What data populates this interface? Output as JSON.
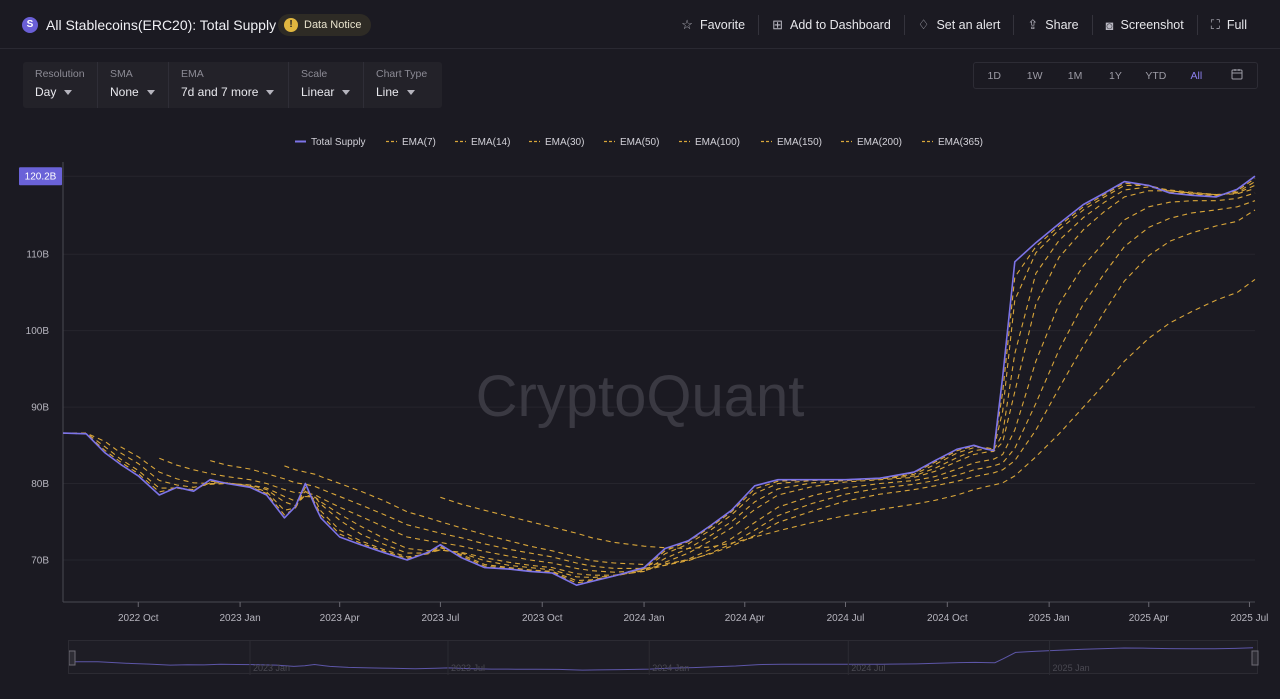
{
  "header": {
    "logo_letter": "S",
    "title": "All Stablecoins(ERC20): Total Supply",
    "notice": "Data Notice",
    "actions": [
      {
        "label": "Favorite",
        "icon": "star-icon"
      },
      {
        "label": "Add to Dashboard",
        "icon": "dashboard-add-icon"
      },
      {
        "label": "Set an alert",
        "icon": "bell-icon"
      },
      {
        "label": "Share",
        "icon": "share-icon"
      },
      {
        "label": "Screenshot",
        "icon": "camera-icon"
      },
      {
        "label": "Full",
        "icon": "fullscreen-icon"
      }
    ]
  },
  "controls": [
    {
      "label": "Resolution",
      "value": "Day"
    },
    {
      "label": "SMA",
      "value": "None"
    },
    {
      "label": "EMA",
      "value": "7d and 7 more"
    },
    {
      "label": "Scale",
      "value": "Linear"
    },
    {
      "label": "Chart Type",
      "value": "Line"
    }
  ],
  "ranges": [
    "1D",
    "1W",
    "1M",
    "1Y",
    "YTD",
    "All"
  ],
  "active_range": "All",
  "colors": {
    "supply": "#7d74e8",
    "ema": "#d9a63a",
    "background": "#1b1a22",
    "current_label": "#6a62d8"
  },
  "chart_data": {
    "type": "line",
    "watermark": "CryptoQuant",
    "current_value_label": "120.2B",
    "current_value": 120.2,
    "y_ticks": [
      {
        "label": "70B",
        "value": 70
      },
      {
        "label": "80B",
        "value": 80
      },
      {
        "label": "90B",
        "value": 90
      },
      {
        "label": "100B",
        "value": 100
      },
      {
        "label": "110B",
        "value": 110
      }
    ],
    "ylim": [
      64.5,
      121.8
    ],
    "x_ticks": [
      {
        "label": "2022 Oct",
        "date": "2022-10-01"
      },
      {
        "label": "2023 Jan",
        "date": "2023-01-01"
      },
      {
        "label": "2023 Apr",
        "date": "2023-04-01"
      },
      {
        "label": "2023 Jul",
        "date": "2023-07-01"
      },
      {
        "label": "2023 Oct",
        "date": "2023-10-01"
      },
      {
        "label": "2024 Jan",
        "date": "2024-01-01"
      },
      {
        "label": "2024 Apr",
        "date": "2024-04-01"
      },
      {
        "label": "2024 Jul",
        "date": "2024-07-01"
      },
      {
        "label": "2024 Oct",
        "date": "2024-10-01"
      },
      {
        "label": "2025 Jan",
        "date": "2025-01-01"
      },
      {
        "label": "2025 Apr",
        "date": "2025-04-01"
      },
      {
        "label": "2025 Jul",
        "date": "2025-07-01"
      }
    ],
    "xlim": [
      "2022-07-25",
      "2025-07-06"
    ],
    "navigator_labels": [
      "2023 Jan",
      "2023 Jul",
      "2024 Jan",
      "2024 Jul",
      "2025 Jan"
    ],
    "x": [
      "2022-07-25",
      "2022-08-15",
      "2022-09-01",
      "2022-09-15",
      "2022-10-01",
      "2022-10-20",
      "2022-11-05",
      "2022-11-20",
      "2022-12-05",
      "2022-12-20",
      "2023-01-10",
      "2023-01-25",
      "2023-02-10",
      "2023-02-20",
      "2023-03-01",
      "2023-03-10",
      "2023-03-15",
      "2023-04-01",
      "2023-04-20",
      "2023-05-10",
      "2023-06-01",
      "2023-06-20",
      "2023-07-01",
      "2023-07-20",
      "2023-08-10",
      "2023-09-01",
      "2023-09-20",
      "2023-10-10",
      "2023-11-01",
      "2023-11-15",
      "2023-12-05",
      "2024-01-01",
      "2024-01-20",
      "2024-02-10",
      "2024-03-01",
      "2024-03-20",
      "2024-04-10",
      "2024-05-01",
      "2024-06-01",
      "2024-07-01",
      "2024-08-01",
      "2024-09-01",
      "2024-09-20",
      "2024-10-10",
      "2024-10-25",
      "2024-11-05",
      "2024-11-12",
      "2024-11-20",
      "2024-12-01",
      "2024-12-20",
      "2025-01-10",
      "2025-02-01",
      "2025-02-20",
      "2025-03-10",
      "2025-04-01",
      "2025-04-20",
      "2025-05-10",
      "2025-06-01",
      "2025-06-20",
      "2025-07-06"
    ],
    "series": [
      {
        "name": "Total Supply",
        "style": "solid",
        "values": [
          86.6,
          86.5,
          84.0,
          82.5,
          81.0,
          78.5,
          79.5,
          79.0,
          80.5,
          80.0,
          79.5,
          78.5,
          75.5,
          77.0,
          80.0,
          77.0,
          75.5,
          73.0,
          72.0,
          71.0,
          70.0,
          71.0,
          72.0,
          70.3,
          69.0,
          68.8,
          68.5,
          68.3,
          66.7,
          67.2,
          67.9,
          69.0,
          71.5,
          72.5,
          74.5,
          76.5,
          79.7,
          80.5,
          80.5,
          80.5,
          80.7,
          81.5,
          83.0,
          84.5,
          85.0,
          84.5,
          84.3,
          94.0,
          109.0,
          111.5,
          114.0,
          116.5,
          118.0,
          119.5,
          119.0,
          118.0,
          117.7,
          117.5,
          118.5,
          120.2
        ]
      },
      {
        "name": "EMA(7)",
        "style": "dashed",
        "values": [
          86.6,
          86.5,
          84.3,
          82.8,
          81.3,
          78.9,
          79.4,
          79.1,
          80.3,
          80.1,
          79.6,
          78.7,
          75.9,
          76.8,
          79.5,
          77.4,
          75.9,
          73.4,
          72.2,
          71.2,
          70.2,
          70.9,
          71.8,
          70.5,
          69.2,
          68.9,
          68.6,
          68.4,
          67.0,
          67.3,
          67.9,
          68.9,
          71.2,
          72.4,
          74.3,
          76.3,
          79.3,
          80.3,
          80.5,
          80.5,
          80.7,
          81.4,
          82.8,
          84.3,
          84.9,
          84.6,
          84.4,
          92.0,
          107.0,
          111.0,
          113.7,
          116.2,
          117.8,
          119.3,
          119.0,
          118.1,
          117.8,
          117.6,
          118.3,
          119.9
        ]
      },
      {
        "name": "EMA(14)",
        "style": "dashed",
        "values": [
          86.6,
          86.6,
          84.8,
          83.2,
          81.7,
          79.4,
          79.4,
          79.2,
          80.1,
          80.1,
          79.7,
          78.9,
          76.5,
          76.8,
          79.0,
          77.8,
          76.4,
          73.9,
          72.5,
          71.4,
          70.4,
          70.8,
          71.6,
          70.7,
          69.4,
          69.0,
          68.7,
          68.5,
          67.3,
          67.4,
          67.9,
          68.8,
          70.8,
          72.1,
          73.9,
          75.9,
          78.7,
          80.0,
          80.4,
          80.5,
          80.7,
          81.2,
          82.5,
          84.0,
          84.7,
          84.7,
          84.5,
          89.5,
          104.0,
          110.2,
          113.2,
          115.8,
          117.5,
          119.0,
          119.0,
          118.3,
          117.9,
          117.7,
          118.1,
          119.5
        ]
      },
      {
        "name": "EMA(30)",
        "style": "dashed",
        "values": [
          86.6,
          86.6,
          85.5,
          84.0,
          82.6,
          80.4,
          79.8,
          79.5,
          79.9,
          80.0,
          79.8,
          79.2,
          77.6,
          77.1,
          78.5,
          78.2,
          77.3,
          75.2,
          73.4,
          72.1,
          70.9,
          70.9,
          71.3,
          70.9,
          69.9,
          69.3,
          69.0,
          68.7,
          67.8,
          67.7,
          67.9,
          68.6,
          70.2,
          71.5,
          73.2,
          75.0,
          77.6,
          79.3,
          80.1,
          80.4,
          80.6,
          81.0,
          82.0,
          83.4,
          84.3,
          84.5,
          84.4,
          86.5,
          97.0,
          107.5,
          111.8,
          114.8,
          116.8,
          118.4,
          118.8,
          118.4,
          118.1,
          117.8,
          118.0,
          119.0
        ]
      },
      {
        "name": "EMA(50)",
        "style": "dashed",
        "values": [
          null,
          null,
          null,
          84.8,
          83.5,
          81.5,
          80.6,
          80.1,
          80.0,
          80.0,
          79.8,
          79.4,
          78.3,
          77.7,
          78.3,
          78.2,
          77.6,
          76.0,
          74.4,
          72.9,
          71.5,
          71.2,
          71.3,
          71.0,
          70.3,
          69.7,
          69.3,
          69.0,
          68.2,
          68.0,
          68.0,
          68.5,
          69.7,
          70.9,
          72.5,
          74.2,
          76.6,
          78.5,
          79.6,
          80.2,
          80.5,
          80.8,
          81.6,
          82.9,
          83.8,
          84.1,
          84.2,
          85.4,
          92.0,
          103.5,
          109.6,
          113.2,
          115.6,
          117.5,
          118.3,
          118.3,
          118.0,
          117.8,
          117.9,
          118.6
        ]
      },
      {
        "name": "EMA(100)",
        "style": "dashed",
        "values": [
          null,
          null,
          null,
          null,
          null,
          83.3,
          82.4,
          81.8,
          81.3,
          80.9,
          80.5,
          80.0,
          79.2,
          78.8,
          78.8,
          78.5,
          78.1,
          76.9,
          75.7,
          74.4,
          73.0,
          72.5,
          72.3,
          71.8,
          71.1,
          70.5,
          70.0,
          69.6,
          68.9,
          68.6,
          68.4,
          68.6,
          69.3,
          70.1,
          71.4,
          72.8,
          74.9,
          76.9,
          78.4,
          79.4,
          80.0,
          80.4,
          80.9,
          81.9,
          82.7,
          83.0,
          83.2,
          83.8,
          87.0,
          96.0,
          103.5,
          108.5,
          111.6,
          114.5,
          116.2,
          116.8,
          117.0,
          117.0,
          117.3,
          118.0
        ]
      },
      {
        "name": "EMA(150)",
        "style": "dashed",
        "values": [
          null,
          null,
          null,
          null,
          null,
          null,
          null,
          null,
          83.0,
          82.4,
          81.9,
          81.3,
          80.6,
          80.1,
          79.9,
          79.6,
          79.3,
          78.3,
          77.2,
          76.0,
          74.6,
          73.9,
          73.5,
          72.9,
          72.1,
          71.4,
          70.9,
          70.4,
          69.6,
          69.2,
          68.9,
          68.9,
          69.3,
          69.9,
          70.9,
          72.1,
          73.9,
          75.8,
          77.4,
          78.6,
          79.4,
          79.9,
          80.4,
          81.1,
          81.8,
          82.1,
          82.3,
          82.7,
          84.6,
          90.5,
          97.5,
          103.5,
          107.5,
          111.0,
          113.5,
          114.7,
          115.4,
          115.8,
          116.2,
          117.0
        ]
      },
      {
        "name": "EMA(200)",
        "style": "dashed",
        "values": [
          null,
          null,
          null,
          null,
          null,
          null,
          null,
          null,
          null,
          null,
          null,
          null,
          82.3,
          81.8,
          81.5,
          81.2,
          80.9,
          80.0,
          79.0,
          77.8,
          76.3,
          75.5,
          75.0,
          74.2,
          73.3,
          72.5,
          71.8,
          71.2,
          70.4,
          69.9,
          69.6,
          69.4,
          69.5,
          70.0,
          70.8,
          71.8,
          73.2,
          74.9,
          76.4,
          77.7,
          78.6,
          79.2,
          79.7,
          80.3,
          80.9,
          81.2,
          81.4,
          81.8,
          83.0,
          87.0,
          92.5,
          98.0,
          102.5,
          106.5,
          109.8,
          111.7,
          112.8,
          113.7,
          114.3,
          115.8
        ]
      },
      {
        "name": "EMA(365)",
        "style": "dashed",
        "values": [
          null,
          null,
          null,
          null,
          null,
          null,
          null,
          null,
          null,
          null,
          null,
          null,
          null,
          null,
          null,
          null,
          null,
          null,
          null,
          null,
          null,
          null,
          78.2,
          77.3,
          76.5,
          75.7,
          75.0,
          74.3,
          73.5,
          72.9,
          72.3,
          71.8,
          71.6,
          71.5,
          71.7,
          72.2,
          73.0,
          73.8,
          74.9,
          75.8,
          76.6,
          77.3,
          77.8,
          78.5,
          79.2,
          79.6,
          79.8,
          80.1,
          81.0,
          83.5,
          86.5,
          90.0,
          93.0,
          96.0,
          99.0,
          101.0,
          102.5,
          104.0,
          105.0,
          106.7
        ]
      }
    ]
  }
}
